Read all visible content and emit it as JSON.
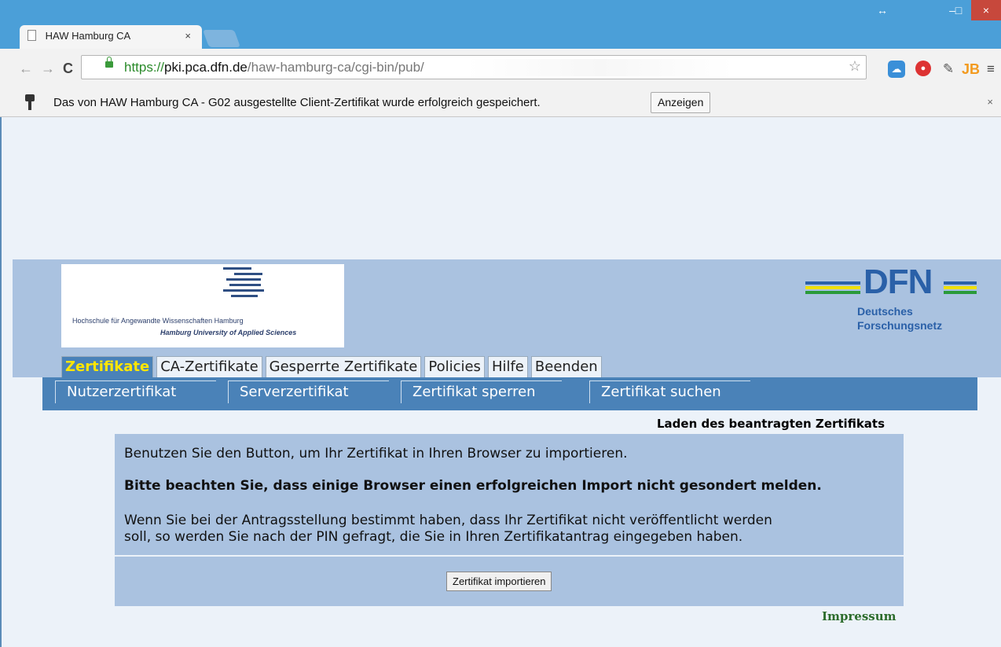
{
  "browser": {
    "tab_title": "HAW Hamburg CA",
    "tab_close": "×",
    "window_controls": {
      "resize": "↔",
      "minimize": "–",
      "maximize": "□",
      "close": "×"
    },
    "url": {
      "scheme": "https://",
      "host": "pki.pca.dfn.de",
      "path": "/haw-hamburg-ca/cgi-bin/pub/"
    },
    "extensions": [
      "cloud-icon",
      "stop-icon",
      "wrench-icon",
      "jb-icon"
    ],
    "ext_jb_label": "JB",
    "menu_icon": "≡"
  },
  "infobar": {
    "message": "Das von HAW Hamburg CA - G02 ausgestellte Client-Zertifikat wurde erfolgreich gespeichert.",
    "button": "Anzeigen",
    "close": "×"
  },
  "header": {
    "haw_name_de": "Hochschule für Angewandte Wissenschaften Hamburg",
    "haw_name_en": "Hamburg University of Applied Sciences",
    "dfn_logo": "DFN",
    "dfn_line1": "Deutsches",
    "dfn_line2": "Forschungsnetz"
  },
  "tabs": [
    "Zertifikate",
    "CA-Zertifikate",
    "Gesperrte Zertifikate",
    "Policies",
    "Hilfe",
    "Beenden"
  ],
  "active_tab": "Zertifikate",
  "subnav": [
    "Nutzerzertifikat",
    "Serverzertifikat",
    "Zertifikat sperren",
    "Zertifikat suchen"
  ],
  "content": {
    "section_title": "Laden des beantragten Zertifikats",
    "p1": "Benutzen Sie den Button, um Ihr Zertifikat in Ihren Browser zu importieren.",
    "p2": "Bitte beachten Sie, dass einige Browser einen erfolgreichen Import nicht gesondert melden.",
    "p3_line1": "Wenn Sie bei der Antragsstellung bestimmt haben, dass Ihr Zertifikat nicht veröffentlicht werden",
    "p3_line2": "soll, so werden Sie nach der PIN gefragt, die Sie in Ihren Zertifikatantrag eingegeben haben.",
    "import_button": "Zertifikat importieren"
  },
  "footer": {
    "impressum": "Impressum"
  },
  "colors": {
    "header_band": "#aac2e0",
    "subnav": "#4a82b8",
    "active_tab_text": "#ffe600",
    "dfn_blue": "#2a60a8"
  }
}
